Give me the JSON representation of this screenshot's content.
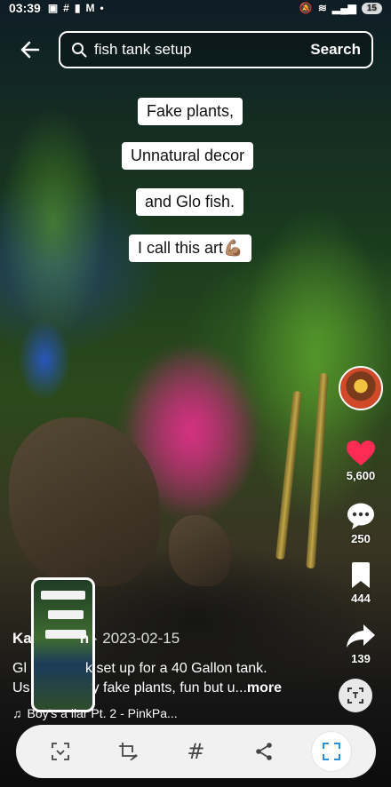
{
  "status_bar": {
    "time": "03:39",
    "notif_icons": [
      "camera-scan-icon",
      "hash-icon",
      "alarm-icon",
      "gmail-icon",
      "dot-icon"
    ],
    "battery": "15"
  },
  "search": {
    "query": "fish tank setup",
    "button_label": "Search"
  },
  "video": {
    "captions": [
      "Fake plants,",
      "Unnatural decor",
      "and Glo fish.",
      "I call this art💪🏽"
    ],
    "author": "Ka",
    "author_hidden": "h",
    "date": "2023-02-15",
    "description_line1_a": "Gl",
    "description_line1_b": "k set up for a 40 Gallon tank.",
    "description_line2_a": "Us",
    "description_line2_b": "y fake plants, fun but u...",
    "more_label": "more",
    "sound": "Boy's a liar Pt. 2 - PinkPa..."
  },
  "rail": {
    "likes": "5,600",
    "comments": "250",
    "saves": "444",
    "shares": "139"
  },
  "toolbar": {
    "icons": [
      "smart-select-icon",
      "crop-edit-icon",
      "hashtag-icon",
      "share-icon",
      "expand-icon"
    ]
  },
  "colors": {
    "like_red": "#fe2c55",
    "toolbar_bg": "#f1f1f1"
  }
}
